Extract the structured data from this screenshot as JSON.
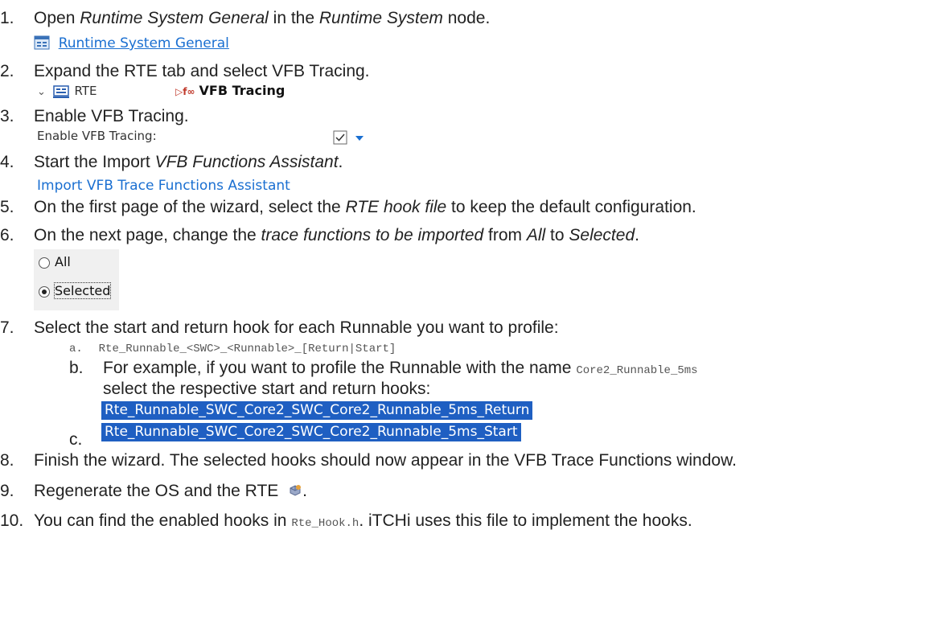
{
  "steps": [
    {
      "num": "1.",
      "parts": [
        "Open ",
        "Runtime System General",
        " in the ",
        "Runtime System",
        " node."
      ]
    },
    {
      "num": "2.",
      "text": "Expand the RTE tab and select VFB Tracing."
    },
    {
      "num": "3.",
      "text": "Enable VFB Tracing."
    },
    {
      "num": "4.",
      "parts": [
        "Start the Import ",
        "VFB Functions Assistant",
        "."
      ]
    },
    {
      "num": "5.",
      "parts": [
        "On the first page of the wizard, select the ",
        "RTE hook file",
        " to keep the default configuration."
      ]
    },
    {
      "num": "6.",
      "parts": [
        "On the next page, change the ",
        "trace functions to be imported",
        " from ",
        "All",
        " to ",
        "Selected",
        "."
      ]
    },
    {
      "num": "7.",
      "text": "Select the start and return hook for each Runnable you want to profile:"
    },
    {
      "num": "8.",
      "text": "Finish the wizard. The selected hooks should now appear in the VFB Trace Functions window."
    },
    {
      "num": "9.",
      "text": "Regenerate the OS and the RTE"
    },
    {
      "num": "10.",
      "parts": [
        "You can find the enabled hooks in ",
        "Rte_Hook.h",
        ". iTCHi uses this file to implement the hooks."
      ]
    }
  ],
  "substeps": {
    "a": {
      "label": "a.",
      "code": "Rte_Runnable_<SWC>_<Runnable>_[Return|Start]"
    },
    "b": {
      "label": "b.",
      "line1": "For example, if you want to profile the Runnable with the name ",
      "code": "Core2_Runnable_5ms",
      "line2": "select the respective start and return hooks:"
    },
    "c": {
      "label": "c."
    }
  },
  "shots": {
    "runtime_link": "Runtime System General",
    "rte_node": "RTE",
    "vfb_tracing": "VFB Tracing",
    "enable_label": "Enable VFB Tracing:",
    "import_link": "Import VFB Trace Functions Assistant",
    "radio_all": "All",
    "radio_selected": "Selected",
    "hook_return": "Rte_Runnable_SWC_Core2_SWC_Core2_Runnable_5ms_Return",
    "hook_start": "Rte_Runnable_SWC_Core2_SWC_Core2_Runnable_5ms_Start"
  }
}
